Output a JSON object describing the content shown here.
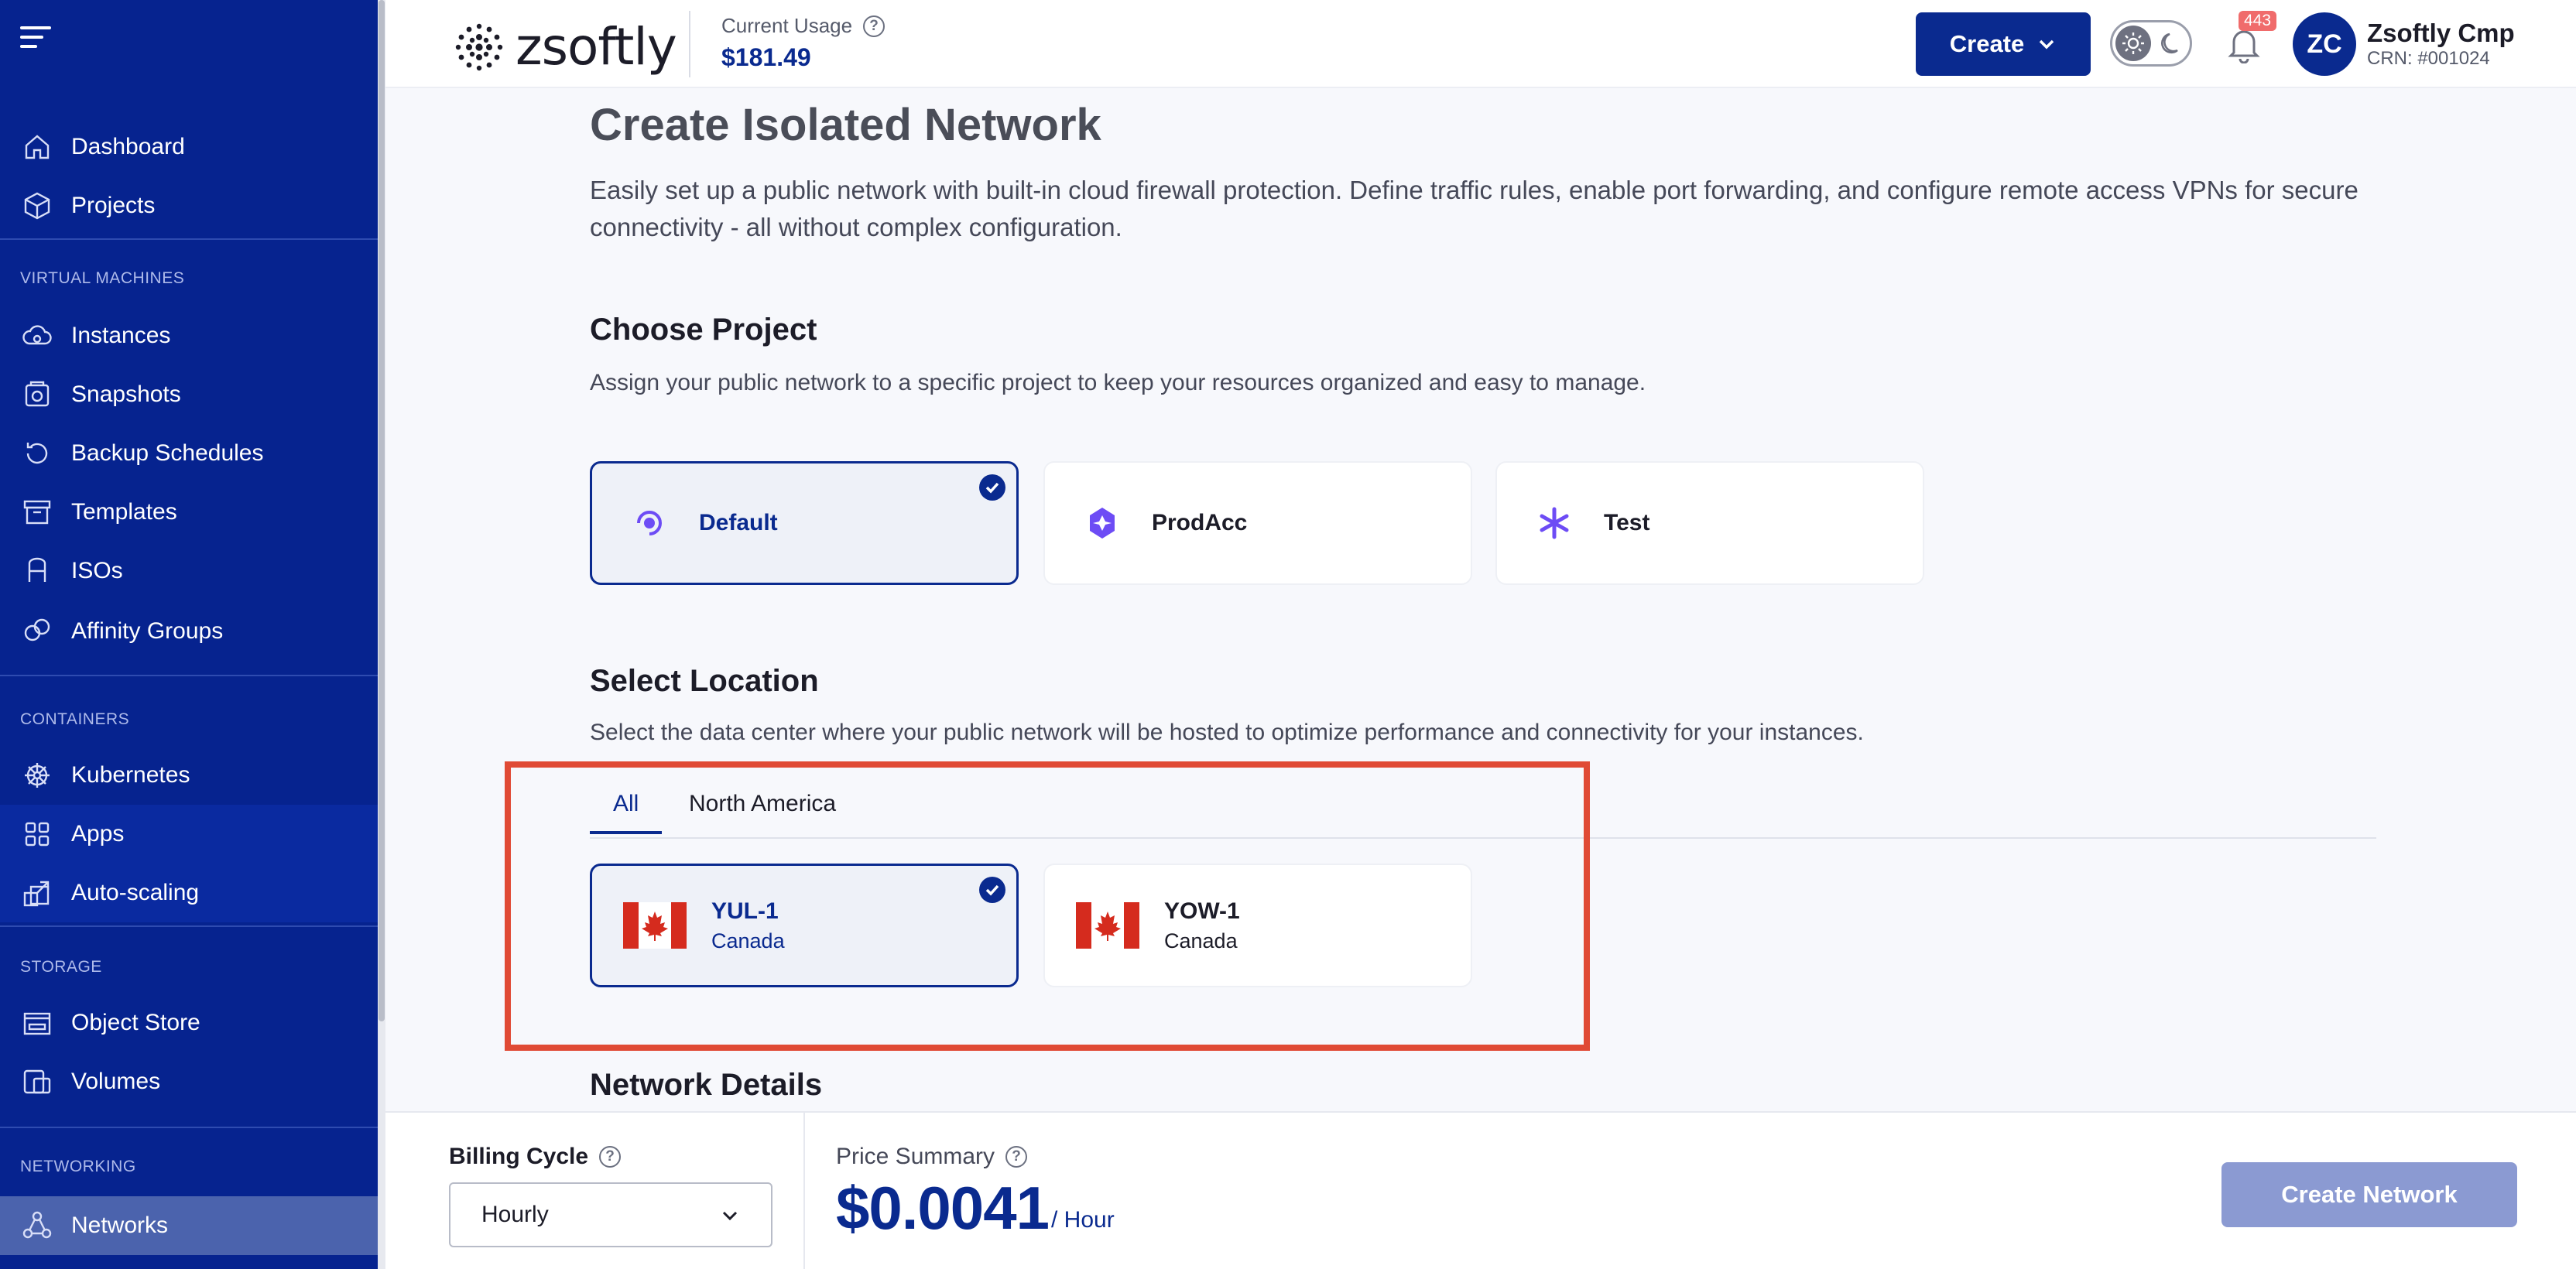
{
  "brand": {
    "name": "zsoftly",
    "primary": "#0a2a8f",
    "highlight": "#e04a35"
  },
  "header": {
    "usage_label": "Current Usage",
    "usage_value": "$181.49",
    "create_label": "Create",
    "notifications_count": "443",
    "avatar_initials": "ZC",
    "user_name": "Zsoftly Cmp",
    "user_crn": "CRN: #001024"
  },
  "sidebar": {
    "top": [
      {
        "label": "Dashboard",
        "icon": "home-icon"
      },
      {
        "label": "Projects",
        "icon": "cube-icon"
      }
    ],
    "sections": [
      {
        "title": "VIRTUAL MACHINES",
        "items": [
          "Instances",
          "Snapshots",
          "Backup Schedules",
          "Templates",
          "ISOs",
          "Affinity Groups"
        ]
      },
      {
        "title": "CONTAINERS",
        "items": [
          "Kubernetes",
          "Apps",
          "Auto-scaling"
        ]
      },
      {
        "title": "STORAGE",
        "items": [
          "Object Store",
          "Volumes"
        ]
      },
      {
        "title": "NETWORKING",
        "items": [
          "Networks"
        ]
      }
    ]
  },
  "page": {
    "title": "Create Isolated Network",
    "description": "Easily set up a public network with built-in cloud firewall protection. Define traffic rules, enable port forwarding, and configure remote access VPNs for secure connectivity - all without complex configuration."
  },
  "project": {
    "title": "Choose Project",
    "description": "Assign your public network to a specific project to keep your resources organized and easy to manage.",
    "options": [
      {
        "label": "Default",
        "selected": true
      },
      {
        "label": "ProdAcc",
        "selected": false
      },
      {
        "label": "Test",
        "selected": false
      }
    ]
  },
  "location": {
    "title": "Select Location",
    "description": "Select the data center where your public network will be hosted to optimize performance and connectivity for your instances.",
    "tabs": [
      "All",
      "North America"
    ],
    "active_tab": "All",
    "options": [
      {
        "name": "YUL-1",
        "country": "Canada",
        "selected": true
      },
      {
        "name": "YOW-1",
        "country": "Canada",
        "selected": false
      }
    ]
  },
  "network_details": {
    "title": "Network Details"
  },
  "footer": {
    "billing_label": "Billing Cycle",
    "billing_value": "Hourly",
    "price_label": "Price Summary",
    "price_value": "$0.0041",
    "price_unit": "/ Hour",
    "submit_label": "Create Network"
  }
}
